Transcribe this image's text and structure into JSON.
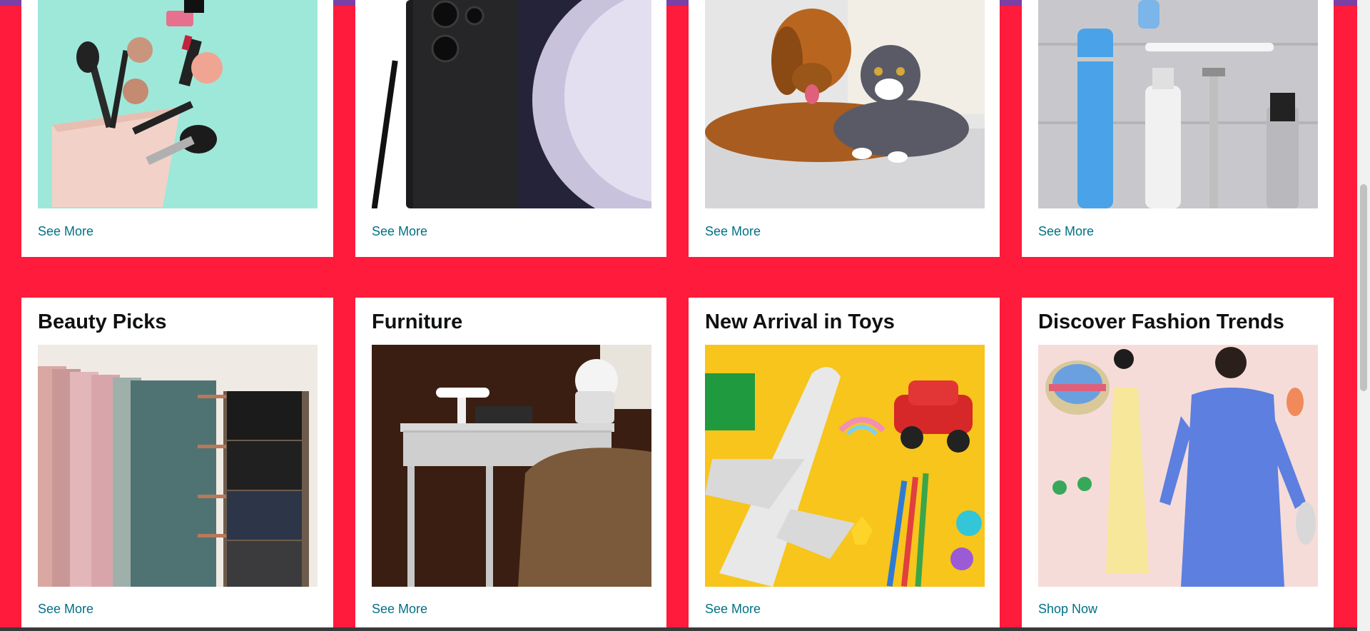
{
  "top_row": [
    {
      "image": "makeup-brushes-cosmetic-bag-image",
      "link": "See More"
    },
    {
      "image": "samsung-phone-stylus-image",
      "link": "See More"
    },
    {
      "image": "dog-and-cat-image",
      "link": "See More"
    },
    {
      "image": "toiletries-razor-toothbrush-image",
      "link": "See More"
    }
  ],
  "bottom_row": [
    {
      "title": "Beauty Picks",
      "image": "pastel-towels-hanger-image",
      "link": "See More"
    },
    {
      "title": "Furniture",
      "image": "white-desk-brown-chair-image",
      "link": "See More"
    },
    {
      "title": "New Arrival in Toys",
      "image": "toy-plane-car-pencils-image",
      "link": "See More"
    },
    {
      "title": "Discover Fashion Trends",
      "image": "women-fashion-outfits-image",
      "link": "Shop Now"
    }
  ],
  "colors": {
    "page_background": "#fe1b3b",
    "link": "#007185",
    "top_bar": "#7b3fa6"
  }
}
